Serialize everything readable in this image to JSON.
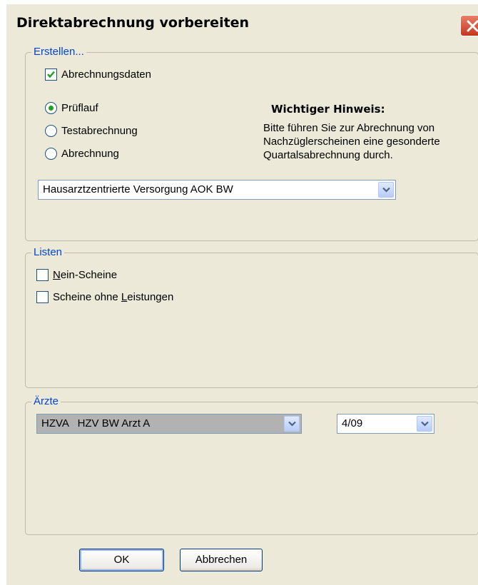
{
  "window": {
    "title": "Direktabrechnung vorbereiten"
  },
  "colors": {
    "legend": "#0046d5",
    "background": "#ece9d8",
    "radio_dot": "#21a121",
    "checkmark": "#21a121"
  },
  "erstellen": {
    "legend": "Erstellen...",
    "abrechnungsdaten": {
      "label": "Abrechnungsdaten",
      "checked": true
    },
    "radios": [
      {
        "label": "Prüflauf",
        "selected": true
      },
      {
        "label": "Testabrechnung",
        "selected": false
      },
      {
        "label": "Abrechnung",
        "selected": false
      }
    ],
    "note": {
      "title": "Wichtiger Hinweis:",
      "lines": [
        "Bitte führen Sie zur Abrechnung von",
        "Nachzüglerscheinen eine gesonderte",
        "Quartalsabrechnung durch."
      ]
    },
    "select_value": "Hausarztzentrierte Versorgung AOK BW"
  },
  "listen": {
    "legend": "Listen",
    "nein_scheine": {
      "label_first": "N",
      "label_rest": "ein-Scheine",
      "checked": false
    },
    "scheine_ohne": {
      "label_prefix": "Scheine ohne ",
      "label_u": "L",
      "label_suffix": "eistungen",
      "checked": false
    }
  },
  "aerzte": {
    "legend": "Ärzte",
    "arzt_value": "HZVA   HZV BW Arzt A",
    "quarter_value": "4/09"
  },
  "buttons": {
    "ok": "OK",
    "cancel": "Abbrechen"
  }
}
